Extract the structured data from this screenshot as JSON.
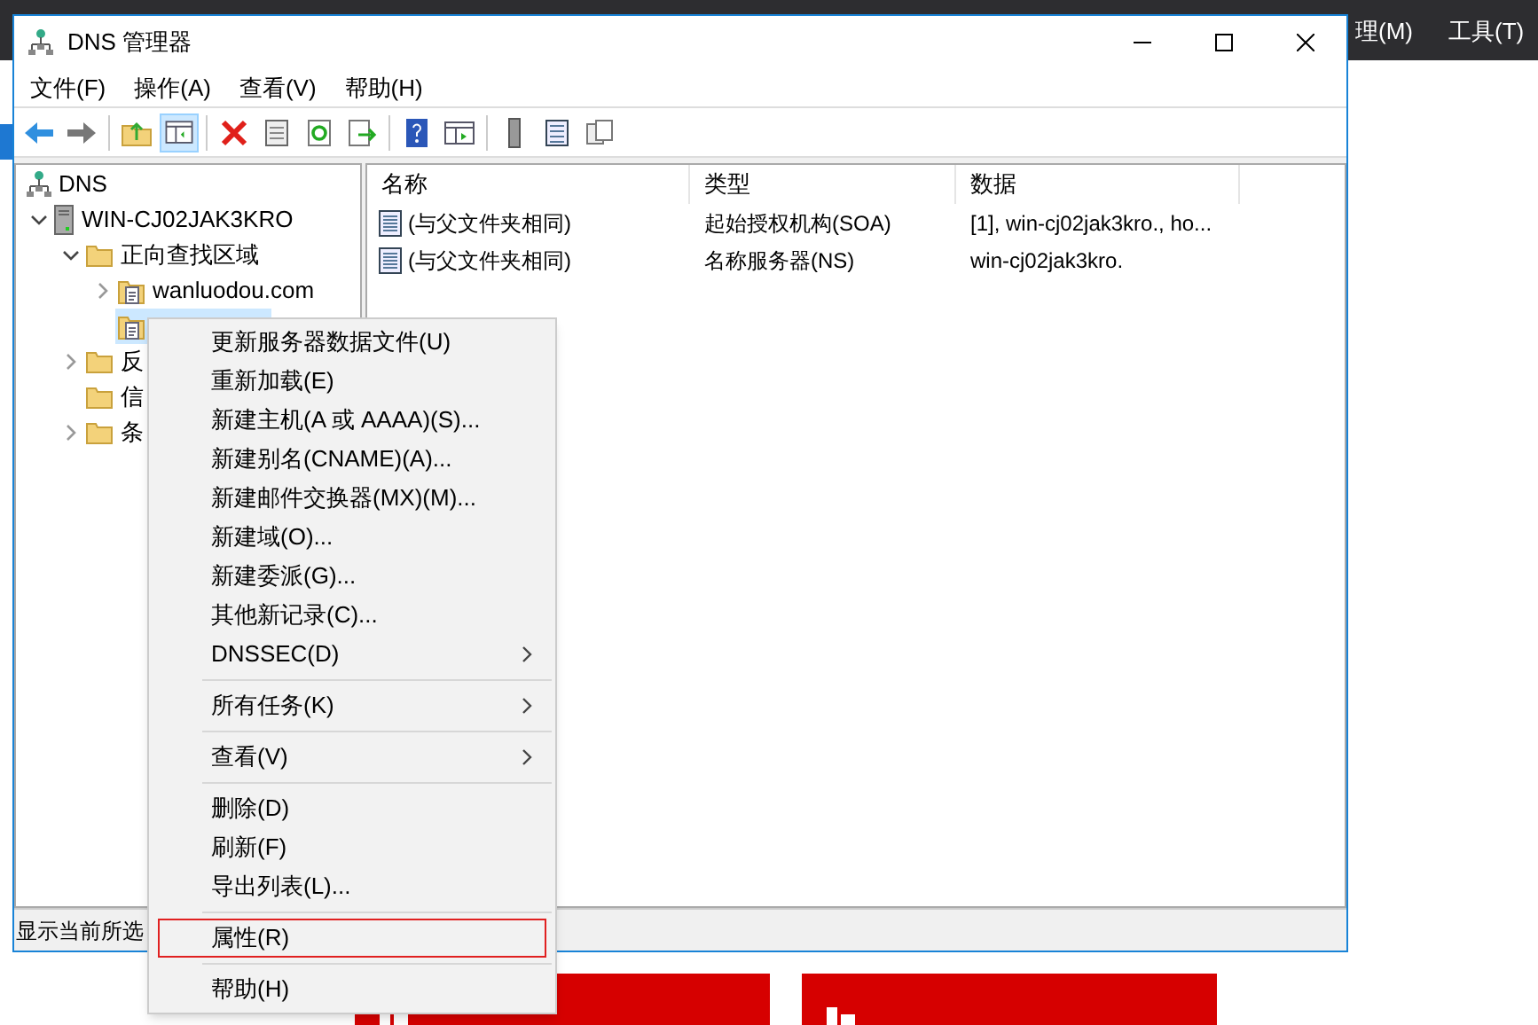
{
  "background": {
    "menu_fragments": [
      "理(M)",
      "工具(T)"
    ]
  },
  "window": {
    "title": "DNS 管理器",
    "menu": [
      "文件(F)",
      "操作(A)",
      "查看(V)",
      "帮助(H)"
    ],
    "tree": [
      {
        "label": "DNS",
        "kind": "dns",
        "selected": false,
        "children": [
          {
            "label": "WIN-CJ02JAK3KRO",
            "kind": "server",
            "expanded": true,
            "has_children": true,
            "selected": false,
            "children": [
              {
                "label": "正向查找区域",
                "kind": "folder",
                "expanded": true,
                "has_children": true,
                "selected": false,
                "children": [
                  {
                    "label": "wanluodou.com",
                    "kind": "zone",
                    "expanded": false,
                    "has_children": true,
                    "selected": false
                  },
                  {
                    "kind": "zone",
                    "has_children": false,
                    "selected": true
                  }
                ]
              },
              {
                "label": "反",
                "kind": "folder",
                "expanded": false,
                "has_children": true,
                "selected": false
              },
              {
                "label": "信",
                "kind": "folder",
                "has_children": false,
                "selected": false
              },
              {
                "label": "条",
                "kind": "folder",
                "expanded": false,
                "has_children": true,
                "selected": false
              }
            ]
          }
        ]
      }
    ],
    "table": {
      "columns": [
        "名称",
        "类型",
        "数据"
      ],
      "rows": [
        [
          "(与父文件夹相同)",
          "起始授权机构(SOA)",
          "[1], win-cj02jak3kro., ho..."
        ],
        [
          "(与父文件夹相同)",
          "名称服务器(NS)",
          "win-cj02jak3kro."
        ]
      ]
    },
    "status_bar": "显示当前所选"
  },
  "context_menu": [
    {
      "kind": "item",
      "label": "更新服务器数据文件(U)",
      "highlighted": false
    },
    {
      "kind": "item",
      "label": "重新加载(E)",
      "highlighted": false
    },
    {
      "kind": "item",
      "label": "新建主机(A 或 AAAA)(S)...",
      "highlighted": false
    },
    {
      "kind": "item",
      "label": "新建别名(CNAME)(A)...",
      "highlighted": false
    },
    {
      "kind": "item",
      "label": "新建邮件交换器(MX)(M)...",
      "highlighted": false
    },
    {
      "kind": "item",
      "label": "新建域(O)...",
      "highlighted": false
    },
    {
      "kind": "item",
      "label": "新建委派(G)...",
      "highlighted": false
    },
    {
      "kind": "item",
      "label": "其他新记录(C)...",
      "highlighted": false
    },
    {
      "kind": "submenu",
      "label": "DNSSEC(D)",
      "highlighted": false
    },
    {
      "kind": "separator"
    },
    {
      "kind": "submenu",
      "label": "所有任务(K)",
      "highlighted": false
    },
    {
      "kind": "separator"
    },
    {
      "kind": "submenu",
      "label": "查看(V)",
      "highlighted": false
    },
    {
      "kind": "separator"
    },
    {
      "kind": "item",
      "label": "删除(D)",
      "highlighted": false
    },
    {
      "kind": "item",
      "label": "刷新(F)",
      "highlighted": false
    },
    {
      "kind": "item",
      "label": "导出列表(L)...",
      "highlighted": false
    },
    {
      "kind": "separator"
    },
    {
      "kind": "item",
      "label": "属性(R)",
      "highlighted": true
    },
    {
      "kind": "separator"
    },
    {
      "kind": "item",
      "label": "帮助(H)",
      "highlighted": false
    }
  ]
}
